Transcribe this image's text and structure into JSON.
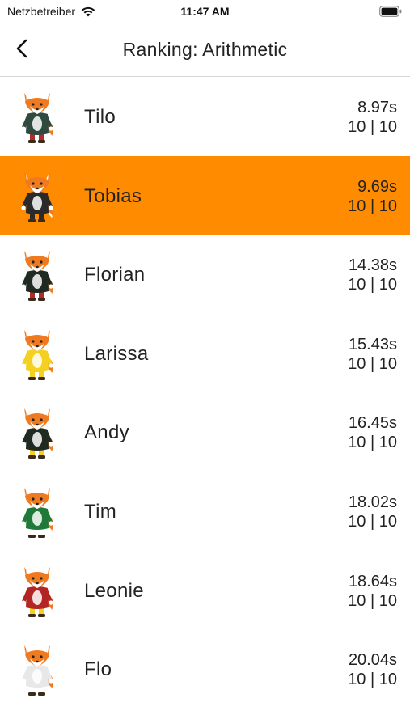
{
  "status_bar": {
    "carrier": "Netzbetreiber",
    "time": "11:47 AM"
  },
  "nav": {
    "title": "Ranking: Arithmetic",
    "back_icon": "chevron-left-icon"
  },
  "colors": {
    "highlight": "#ff8c00",
    "fox_orange": "#f07a1f",
    "text": "#222222"
  },
  "rankings": [
    {
      "name": "Tilo",
      "time": "8.97s",
      "score": "10 | 10",
      "outfit": "#2f4a3e",
      "legs": "#b22a2a",
      "highlight": false
    },
    {
      "name": "Tobias",
      "time": "9.69s",
      "score": "10 | 10",
      "outfit": "#2a2a2a",
      "legs": "#2a2a2a",
      "highlight": true
    },
    {
      "name": "Florian",
      "time": "14.38s",
      "score": "10 | 10",
      "outfit": "#1f2a22",
      "legs": "#b22a2a",
      "highlight": false
    },
    {
      "name": "Larissa",
      "time": "15.43s",
      "score": "10 | 10",
      "outfit": "#f4d020",
      "legs": "#f4d020",
      "highlight": false
    },
    {
      "name": "Andy",
      "time": "16.45s",
      "score": "10 | 10",
      "outfit": "#1f2a22",
      "legs": "#f4d020",
      "highlight": false
    },
    {
      "name": "Tim",
      "time": "18.02s",
      "score": "10 | 10",
      "outfit": "#1f7a3a",
      "legs": "#ffffff",
      "highlight": false
    },
    {
      "name": "Leonie",
      "time": "18.64s",
      "score": "10 | 10",
      "outfit": "#b32525",
      "legs": "#f4d020",
      "highlight": false
    },
    {
      "name": "Flo",
      "time": "20.04s",
      "score": "10 | 10",
      "outfit": "#e8e8e8",
      "legs": "#ffffff",
      "highlight": false
    }
  ]
}
